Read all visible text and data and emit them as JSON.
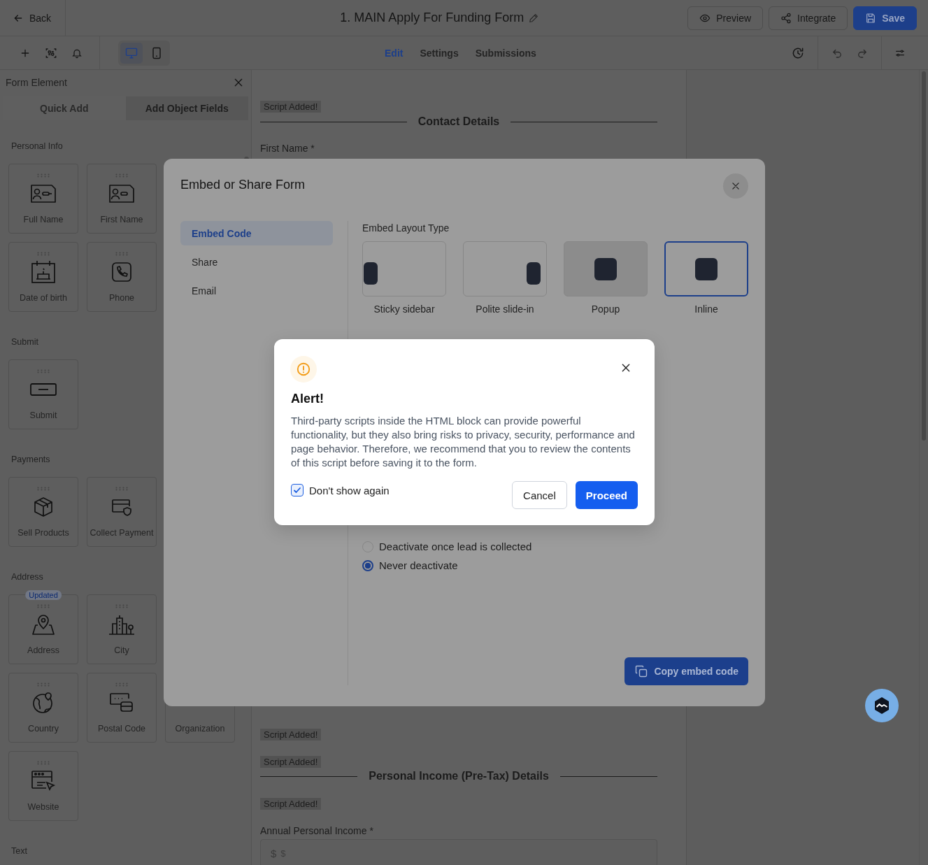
{
  "topbar": {
    "back": "Back",
    "title": "1. MAIN Apply For Funding Form",
    "buttons": [
      {
        "label": "Preview",
        "kind": "preview"
      },
      {
        "label": "Integrate",
        "kind": "integrate"
      },
      {
        "label": "Save",
        "kind": "save"
      }
    ]
  },
  "toolbar": {
    "devices": [
      {
        "kind": "desktop",
        "selected": true
      },
      {
        "kind": "mobile",
        "selected": false
      }
    ],
    "tabs": [
      {
        "label": "Edit",
        "selected": true
      },
      {
        "label": "Settings",
        "selected": false
      },
      {
        "label": "Submissions",
        "selected": false
      }
    ]
  },
  "sidebar": {
    "title": "Form Element",
    "tabs": [
      {
        "label": "Quick Add",
        "selected": true
      },
      {
        "label": "Add Object Fields",
        "selected": false
      }
    ],
    "sections": [
      {
        "title": "Personal Info",
        "rows": [
          [
            {
              "label": "Full Name"
            },
            {
              "label": "First Name"
            }
          ],
          [
            {
              "label": "Date of birth"
            },
            {
              "label": "Phone"
            }
          ]
        ]
      },
      {
        "title": "Submit",
        "rows": [
          [
            {
              "label": "Submit"
            }
          ]
        ]
      },
      {
        "title": "Payments",
        "rows": [
          [
            {
              "label": "Sell Products"
            },
            {
              "label": "Collect Payment"
            }
          ]
        ]
      },
      {
        "title": "Address",
        "rows": [
          [
            {
              "label": "Address",
              "badge": "Updated"
            },
            {
              "label": "City"
            }
          ],
          [
            {
              "label": "Country"
            },
            {
              "label": "Postal Code"
            },
            {
              "label": "Organization"
            }
          ],
          [
            {
              "label": "Website"
            }
          ]
        ]
      },
      {
        "title": "Text"
      }
    ]
  },
  "form": {
    "top": [
      {
        "kind": "tag",
        "text": "Script Added!"
      },
      {
        "kind": "heading",
        "text": "Contact Details"
      },
      {
        "kind": "label",
        "text": "First Name *"
      }
    ],
    "bottom": [
      {
        "kind": "tag",
        "text": "Script Added!"
      },
      {
        "kind": "tag",
        "text": "Script Added!"
      },
      {
        "kind": "heading",
        "text": "Personal Income (Pre-Tax) Details"
      },
      {
        "kind": "tag",
        "text": "Script Added!"
      },
      {
        "kind": "label",
        "text": "Annual Personal Income *"
      },
      {
        "kind": "money",
        "prefix": "$",
        "placeholder": "$"
      }
    ]
  },
  "embed_modal": {
    "title": "Embed or Share Form",
    "nav": [
      {
        "label": "Embed Code",
        "selected": true
      },
      {
        "label": "Share",
        "selected": false
      },
      {
        "label": "Email",
        "selected": false
      }
    ],
    "layout_heading": "Embed Layout Type",
    "layouts": [
      {
        "label": "Sticky sidebar",
        "kind": "left",
        "selected": false,
        "hovered": false
      },
      {
        "label": "Polite slide-in",
        "kind": "right",
        "selected": false,
        "hovered": false
      },
      {
        "label": "Popup",
        "kind": "center",
        "selected": false,
        "hovered": true
      },
      {
        "label": "Inline",
        "kind": "center",
        "selected": true,
        "hovered": false
      }
    ],
    "options": [
      {
        "label": "Deactivate once lead is collected",
        "selected": false
      },
      {
        "label": "Never deactivate",
        "selected": true
      }
    ],
    "copy_button": "Copy embed code"
  },
  "alert": {
    "title": "Alert!",
    "message": "Third-party scripts inside the HTML block can provide powerful functionality, but they also bring risks to privacy, security, performance and page behavior. Therefore, we recommend that you to review the contents of this script before saving it to the form.",
    "checkbox": {
      "label": "Don't show again",
      "checked": true
    },
    "buttons": [
      {
        "label": "Cancel",
        "kind": "secondary"
      },
      {
        "label": "Proceed",
        "kind": "primary"
      }
    ]
  }
}
